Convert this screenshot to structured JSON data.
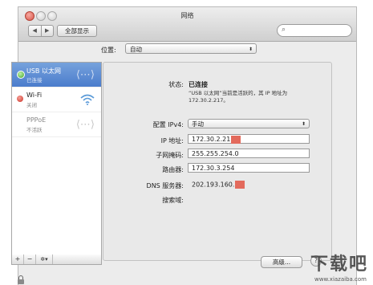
{
  "window": {
    "title": "网络"
  },
  "toolbar": {
    "back": "◀",
    "forward": "▶",
    "show_all": "全部显示",
    "search_placeholder": ""
  },
  "location": {
    "label": "位置:",
    "value": "自动"
  },
  "services": [
    {
      "name": "USB 以太网",
      "status": "已连接",
      "state": "connected",
      "icon": "ethernet-arrows-icon"
    },
    {
      "name": "Wi-Fi",
      "status": "关闭",
      "state": "off",
      "icon": "wifi-icon"
    },
    {
      "name": "PPPoE",
      "status": "不活跃",
      "state": "inactive",
      "icon": "ethernet-arrows-icon"
    }
  ],
  "sidebar_controls": {
    "add": "+",
    "remove": "−",
    "gear": "✲▾"
  },
  "detail": {
    "status_label": "状态:",
    "status_value": "已连接",
    "status_desc": "“USB 以太网”当前是活跃的，其 IP 地址为 172.30.2.217。",
    "config_label": "配置 IPv4:",
    "config_value": "手动",
    "ip_label": "IP 地址:",
    "ip_value": "172.30.2.21",
    "subnet_label": "子网掩码:",
    "subnet_value": "255.255.254.0",
    "router_label": "路由器:",
    "router_value": "172.30.3.254",
    "dns_label": "DNS 服务器:",
    "dns_value": "202.193.160.",
    "search_domain_label": "搜索域:"
  },
  "buttons": {
    "advanced": "高级...",
    "help": "?"
  },
  "watermark": {
    "text": "下载吧",
    "sub": "www.xiazaiba.com"
  },
  "colors": {
    "selection": "#4b7ccc",
    "connected": "#3fa52a",
    "off": "#cc2f21",
    "redaction": "#e36a5c"
  }
}
